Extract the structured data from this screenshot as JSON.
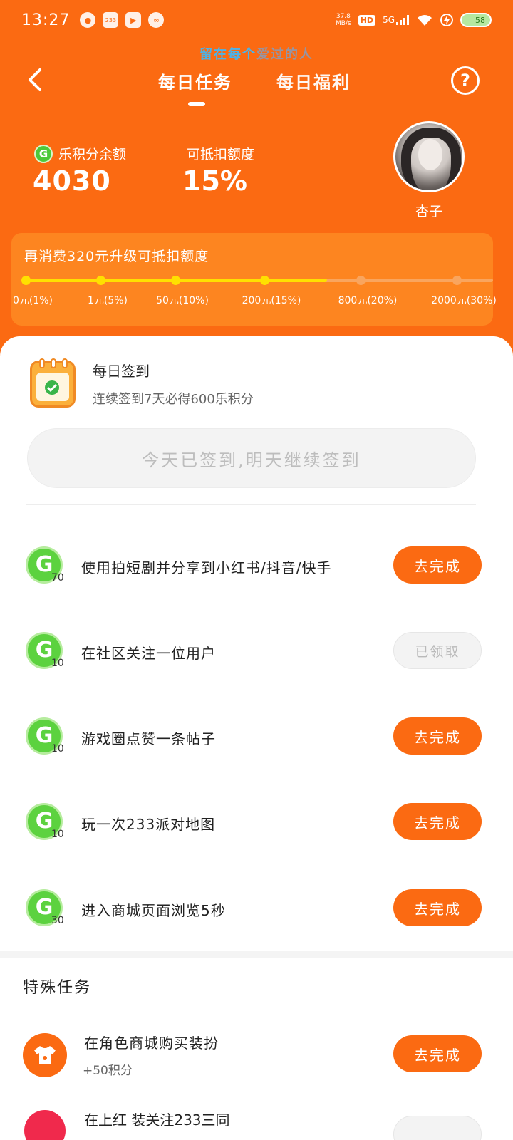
{
  "status_bar": {
    "time": "13:27",
    "speed_value": "37.8",
    "speed_unit": "MB/s",
    "hd": "HD",
    "network": "5G",
    "battery": "58",
    "badge_233": "233"
  },
  "header": {
    "slogan_part1": "留在每个",
    "slogan_part2": "爱过的人",
    "tabs": [
      {
        "label": "每日任务",
        "active": true
      },
      {
        "label": "每日福利",
        "active": false
      }
    ],
    "help_label": "?"
  },
  "account": {
    "points_label": "乐积分余额",
    "points_value": "4030",
    "deduct_label": "可抵扣额度",
    "deduct_value": "15%",
    "username": "杏子"
  },
  "level": {
    "title": "再消费320元升级可抵扣额度",
    "progress_fraction": 0.645,
    "milestones": [
      {
        "label": "0元(1%)",
        "reached": true
      },
      {
        "label": "1元(5%)",
        "reached": true
      },
      {
        "label": "50元(10%)",
        "reached": true
      },
      {
        "label": "200元(15%)",
        "reached": true
      },
      {
        "label": "800元(20%)",
        "reached": false
      },
      {
        "label": "2000元(30%)",
        "reached": false
      }
    ]
  },
  "checkin": {
    "title": "每日签到",
    "subtitle": "连续签到7天必得600乐积分",
    "button_label": "今天已签到,明天继续签到"
  },
  "tasks": [
    {
      "coin": "G",
      "points": "70",
      "name": "使用拍短剧并分享到小红书/抖音/快手",
      "button": "去完成",
      "state": "todo"
    },
    {
      "coin": "G",
      "points": "10",
      "name": "在社区关注一位用户",
      "button": "已领取",
      "state": "claimed"
    },
    {
      "coin": "G",
      "points": "10",
      "name": "游戏圈点赞一条帖子",
      "button": "去完成",
      "state": "todo"
    },
    {
      "coin": "G",
      "points": "10",
      "name": "玩一次233派对地图",
      "button": "去完成",
      "state": "todo"
    },
    {
      "coin": "G",
      "points": "30",
      "name": "进入商城页面浏览5秒",
      "button": "去完成",
      "state": "todo"
    }
  ],
  "special": {
    "title": "特殊任务",
    "items": [
      {
        "name": "在角色商城购买装扮",
        "reward": "+50积分",
        "button": "去完成"
      }
    ],
    "peek_text": "在上红 装关注233三同"
  },
  "colors": {
    "brand_orange": "#fb6a12",
    "coin_green": "#5cd23f",
    "progress_yellow": "#ffe000"
  },
  "icons": [
    "back-arrow-icon",
    "help-icon",
    "g-coin-icon",
    "calendar-check-icon",
    "shirt-icon"
  ]
}
